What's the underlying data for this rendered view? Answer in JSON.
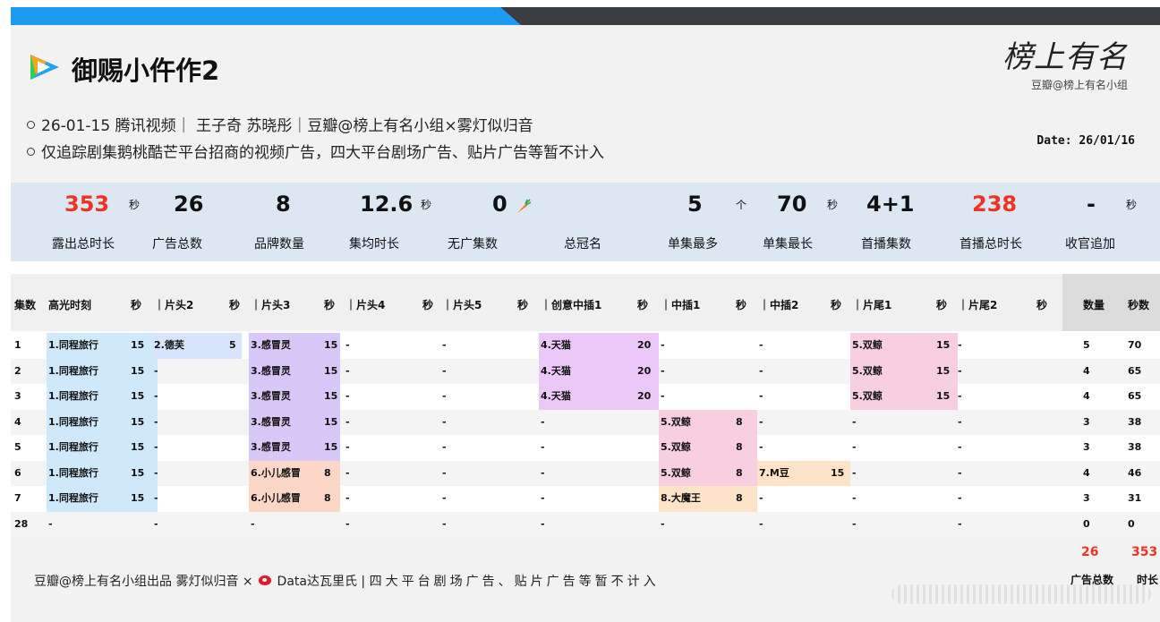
{
  "header": {
    "title": "御赐小仵作2",
    "line1": "26-01-15 腾讯视频｜ 王子奇 苏晓彤｜豆瓣@榜上有名小组×雾灯似归音",
    "line2": "仅追踪剧集鹅桃酷芒平台招商的视频广告，四大平台剧场广告、贴片广告等暂不计入",
    "brand_script": "榜上有名",
    "brand_sub": "豆瓣@榜上有名小组",
    "date": "Date: 26/01/16"
  },
  "stats": [
    {
      "value": "353",
      "unit": "秒",
      "label": "露出总时长",
      "red": true
    },
    {
      "value": "26",
      "unit": "",
      "label": "广告总数",
      "red": false
    },
    {
      "value": "8",
      "unit": "",
      "label": "品牌数量",
      "red": false
    },
    {
      "value": "12.6",
      "unit": "秒",
      "label": "集均时长",
      "red": false
    },
    {
      "value": "0",
      "unit": "",
      "label": "无广集数",
      "red": false
    },
    {
      "value": "",
      "unit": "",
      "label": "总冠名",
      "red": false
    },
    {
      "value": "5",
      "unit": "个",
      "label": "单集最多",
      "red": false
    },
    {
      "value": "70",
      "unit": "秒",
      "label": "单集最长",
      "red": false
    },
    {
      "value": "4+1",
      "unit": "",
      "label": "首播集数",
      "red": false
    },
    {
      "value": "238",
      "unit": "",
      "label": "首播总时长",
      "red": true
    },
    {
      "value": "-",
      "unit": "秒",
      "label": "收官追加",
      "red": false
    }
  ],
  "table": {
    "headers": [
      "集数",
      "高光时刻",
      "秒",
      "｜片头2",
      "秒",
      "｜片头3",
      "秒",
      "｜片头4",
      "秒",
      "｜片头5",
      "秒",
      "｜创意中插1",
      "秒",
      "｜中插1",
      "秒",
      "｜中插2",
      "秒",
      "｜片尾1",
      "秒",
      "｜片尾2",
      "秒",
      "数量",
      "秒数"
    ],
    "rows": [
      [
        "1",
        "1.同程旅行",
        "15",
        "2.德芙",
        "5",
        "3.感冒灵",
        "15",
        "-",
        "",
        "-",
        "",
        "4.天猫",
        "20",
        "-",
        "",
        "-",
        "",
        "5.双鲸",
        "15",
        "-",
        "",
        "5",
        "70"
      ],
      [
        "2",
        "1.同程旅行",
        "15",
        "-",
        "",
        "3.感冒灵",
        "15",
        "-",
        "",
        "-",
        "",
        "4.天猫",
        "20",
        "-",
        "",
        "-",
        "",
        "5.双鲸",
        "15",
        "-",
        "",
        "4",
        "65"
      ],
      [
        "3",
        "1.同程旅行",
        "15",
        "-",
        "",
        "3.感冒灵",
        "15",
        "-",
        "",
        "-",
        "",
        "4.天猫",
        "20",
        "-",
        "",
        "-",
        "",
        "5.双鲸",
        "15",
        "-",
        "",
        "4",
        "65"
      ],
      [
        "4",
        "1.同程旅行",
        "15",
        "-",
        "",
        "3.感冒灵",
        "15",
        "-",
        "",
        "-",
        "",
        "-",
        "",
        "5.双鲸",
        "8",
        "-",
        "",
        "-",
        "",
        "-",
        "",
        "3",
        "38"
      ],
      [
        "5",
        "1.同程旅行",
        "15",
        "-",
        "",
        "3.感冒灵",
        "15",
        "-",
        "",
        "-",
        "",
        "-",
        "",
        "5.双鲸",
        "8",
        "-",
        "",
        "-",
        "",
        "-",
        "",
        "3",
        "38"
      ],
      [
        "6",
        "1.同程旅行",
        "15",
        "-",
        "",
        "6.小儿感冒",
        "8",
        "-",
        "",
        "-",
        "",
        "-",
        "",
        "5.双鲸",
        "8",
        "7.M豆",
        "15",
        "-",
        "",
        "-",
        "",
        "4",
        "46"
      ],
      [
        "7",
        "1.同程旅行",
        "15",
        "-",
        "",
        "6.小儿感冒",
        "8",
        "-",
        "",
        "-",
        "",
        "-",
        "",
        "8.大魔王",
        "8",
        "-",
        "",
        "-",
        "",
        "-",
        "",
        "3",
        "31"
      ],
      [
        "28",
        "-",
        "",
        "-",
        "",
        "-",
        "",
        "-",
        "",
        "-",
        "",
        "-",
        "",
        "-",
        "",
        "-",
        "",
        "-",
        "",
        "-",
        "",
        "0",
        "0"
      ]
    ]
  },
  "footer": {
    "text_a": "豆瓣@榜上有名小组出品 雾灯似归音 ×",
    "text_b": "Data达瓦里氏 |",
    "text_c": "四大平台剧场广告、贴片广告等暂不计入",
    "total_count": "26",
    "total_seconds": "353",
    "total_count_label": "广告总数",
    "total_seconds_label": "时长"
  },
  "colors": {
    "accent_blue": "#1b9cf0",
    "highlight_red": "#ee3322",
    "cell_blue": "#cfe8fa",
    "cell_purple": "#d8c8f7",
    "cell_pink": "#f7cfe0",
    "cell_violet": "#ecc8f9"
  },
  "icons": {
    "logo": "tencent-video-play-icon",
    "carrot": "carrot-icon",
    "weibo": "weibo-icon"
  }
}
